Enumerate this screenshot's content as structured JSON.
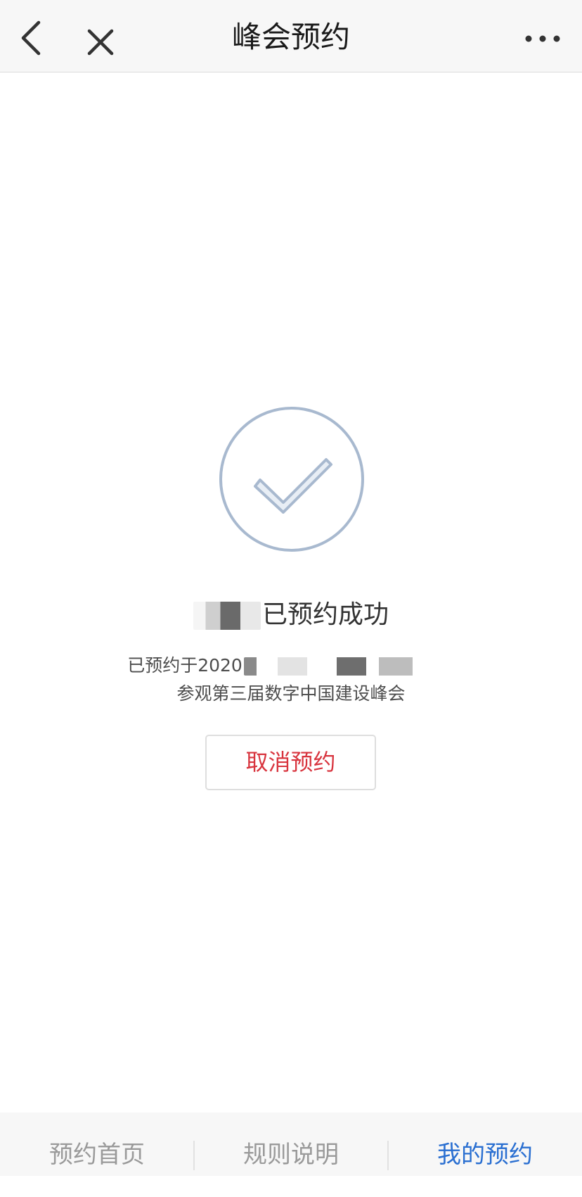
{
  "nav": {
    "title": "峰会预约",
    "back_icon": "back-arrow-icon",
    "close_icon": "close-icon",
    "more_icon": "more-dots-icon"
  },
  "result": {
    "icon": "check-circle-icon",
    "status_text": "已预约成功",
    "detail_prefix": "已预约于2020",
    "event_text": "参观第三届数字中国建设峰会",
    "cancel_label": "取消预约"
  },
  "tabs": [
    {
      "label": "预约首页",
      "active": false
    },
    {
      "label": "规则说明",
      "active": false
    },
    {
      "label": "我的预约",
      "active": true
    }
  ],
  "colors": {
    "active_tab": "#2a6fd1",
    "cancel_text": "#d8343e",
    "icon_stroke": "#a8b9cf",
    "icon_fill": "#e8eef5"
  }
}
